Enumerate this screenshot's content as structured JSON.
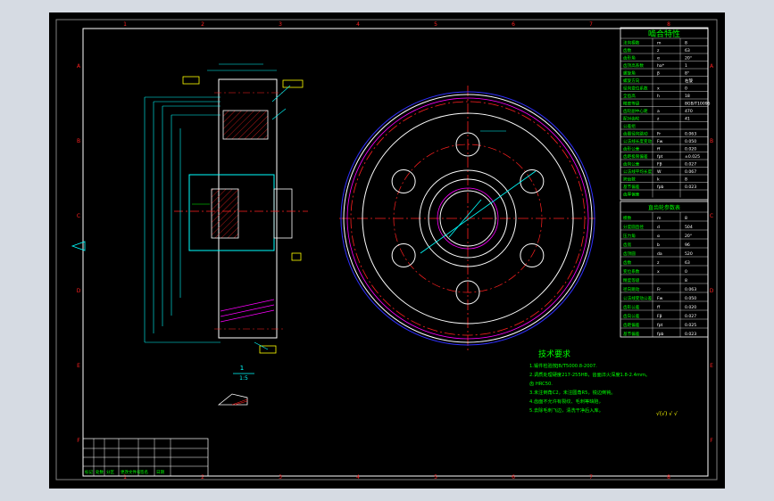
{
  "window": {
    "background": "#d6dbe3",
    "viewport_background": "#000000"
  },
  "frame": {
    "top_numbers": [
      "1",
      "2",
      "3",
      "4",
      "5",
      "6",
      "7",
      "8"
    ],
    "side_letters": [
      "A",
      "B",
      "C",
      "D",
      "E",
      "F"
    ]
  },
  "mesh_table": {
    "title": "啮合特性",
    "rows": [
      [
        "法向模数",
        "m",
        "8"
      ],
      [
        "齿数",
        "z",
        "63"
      ],
      [
        "齿形角",
        "α",
        "20°"
      ],
      [
        "齿顶高系数",
        "ha*",
        "1"
      ],
      [
        "螺旋角",
        "β",
        "8°"
      ],
      [
        "螺旋方向",
        "",
        "右旋"
      ],
      [
        "径向变位系数",
        "x",
        "0"
      ],
      [
        "全齿高",
        "h",
        "18"
      ],
      [
        "精度等级",
        "",
        "8GB/T10095"
      ],
      [
        "齿轮副中心距",
        "a",
        "470"
      ],
      [
        "配对齿轮",
        "z",
        "41"
      ],
      [
        "公差组",
        "",
        ""
      ],
      [
        "齿圈径向跳动",
        "Fr",
        "0.063"
      ],
      [
        "公法线长度变动",
        "Fw",
        "0.050"
      ],
      [
        "齿形公差",
        "ff",
        "0.020"
      ],
      [
        "齿距极限偏差",
        "fpt",
        "±0.025"
      ],
      [
        "齿向公差",
        "Fβ",
        "0.027"
      ],
      [
        "公法线平均长度",
        "W",
        "0.067"
      ],
      [
        "跨齿数",
        "k",
        "8"
      ],
      [
        "基节偏差",
        "fpb",
        "0.023"
      ],
      [
        "齿厚偏差",
        "",
        ""
      ]
    ]
  },
  "spec_table": {
    "title": "直齿轮参数表",
    "rows": [
      [
        "模数",
        "m",
        "8"
      ],
      [
        "分度圆直径",
        "d",
        "504"
      ],
      [
        "压力角",
        "α",
        "20°"
      ],
      [
        "齿宽",
        "b",
        "96"
      ],
      [
        "齿顶圆",
        "da",
        "520"
      ],
      [
        "齿数",
        "z",
        "63"
      ],
      [
        "变位系数",
        "x",
        "0"
      ],
      [
        "精度等级",
        "",
        "8"
      ],
      [
        "径向跳动",
        "Fr",
        "0.063"
      ],
      [
        "公法线变动公差",
        "Fw",
        "0.050"
      ],
      [
        "齿形公差",
        "ff",
        "0.020"
      ],
      [
        "齿向公差",
        "Fβ",
        "0.027"
      ],
      [
        "齿距偏差",
        "fpt",
        "0.025"
      ],
      [
        "基节偏差",
        "fpb",
        "0.023"
      ]
    ]
  },
  "tech_notes": {
    "title": "技术要求",
    "lines": [
      "1.锻件检验按JB/T5000.8-2007.",
      "2.调质处理硬度217-255HB，齿面淬火深度1.8-2.4mm。",
      "齿 HRC50.",
      "3.未注倒角C2，未注圆角R5，锐边倒钝。",
      "4.齿面不允许有裂纹、毛刺等缺陷，",
      "5.去除毛刺飞边，清洗干净后入库。"
    ],
    "roughness": "√(√) √ √"
  },
  "title_block": {
    "labels": [
      "标记",
      "处数",
      "分区",
      "更改文件号",
      "签名",
      "日期"
    ]
  },
  "section_label": {
    "num": "1",
    "scale": "1:5"
  },
  "colors": {
    "frame": "#ffffff",
    "dimension": "#00ffff",
    "center": "#ff2020",
    "green": "#00ff00",
    "hidden": "#ff00ff",
    "yellow": "#ffff00",
    "blue": "#3030ff"
  }
}
